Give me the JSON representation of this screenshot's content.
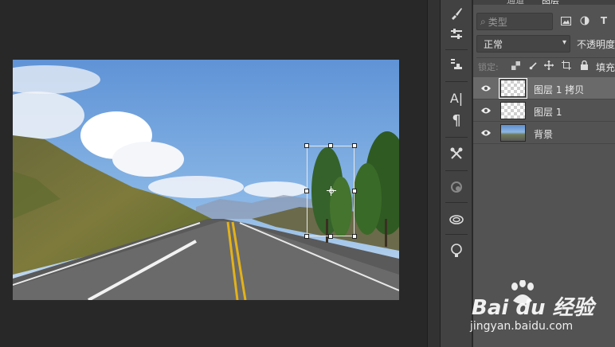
{
  "layers_panel": {
    "tabs": [
      "通道",
      "图层"
    ],
    "filter": {
      "placeholder": "类型",
      "search_glyph": "⌕"
    },
    "filter_icons": [
      "image-icon",
      "adjustment-icon",
      "text-icon"
    ],
    "blend_mode": "正常",
    "opacity_label": "不透明度",
    "lock_label": "锁定:",
    "fill_label": "填充",
    "layers": [
      {
        "name": "图层 1 拷贝",
        "visible": true,
        "active": true,
        "thumb": "transparent"
      },
      {
        "name": "图层 1",
        "visible": true,
        "active": false,
        "thumb": "transparent"
      },
      {
        "name": "背景",
        "visible": true,
        "active": false,
        "thumb": "photo"
      }
    ]
  },
  "tool_strip": {
    "tools": [
      "brush-presets-icon",
      "adjustments-icon",
      "clone-source-icon",
      "character-icon",
      "paragraph-icon",
      "tool-presets-icon",
      "3d-icon",
      "libraries-icon",
      "learn-icon"
    ],
    "glyphs": {
      "character": "A|",
      "paragraph": "¶"
    }
  },
  "watermark": {
    "brand": "Bai du 经验",
    "url": "jingyan.baidu.com"
  },
  "colors": {
    "canvas_bg": "#282828",
    "panel_bg": "#535353",
    "active_layer": "#6a6a6a",
    "sky": "#6fa0d8"
  }
}
